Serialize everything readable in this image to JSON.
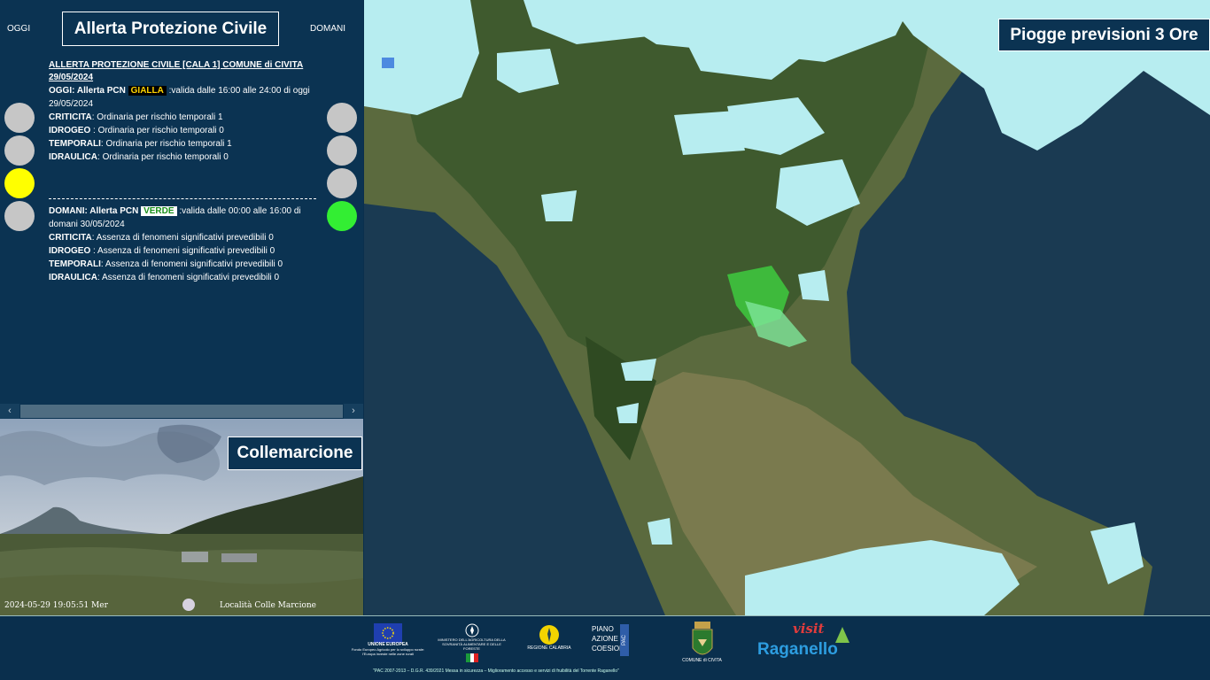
{
  "alert": {
    "title": "Allerta Protezione Civile",
    "left_label": "OGGI",
    "right_label": "DOMANI",
    "header": "ALLERTA PROTEZIONE CIVILE [CALA 1] COMUNE di CIVITA 29/05/2024",
    "today": {
      "prefix": "OGGI: Allerta PCN",
      "level": "GIALLA",
      "validity": ":valida dalle 16:00 alle 24:00 di oggi 29/05/2024",
      "rows": [
        {
          "key": "CRITICITA",
          "sep": ": ",
          "text": "Ordinaria per rischio temporali 1"
        },
        {
          "key": "IDROGEO",
          "sep": " : ",
          "text": "Ordinaria per rischio temporali 0"
        },
        {
          "key": "TEMPORALI",
          "sep": ": ",
          "text": "Ordinaria per rischio temporali 1"
        },
        {
          "key": "IDRAULICA",
          "sep": ": ",
          "text": "Ordinaria per rischio temporali 0"
        }
      ]
    },
    "tomorrow": {
      "prefix": "DOMANI: Allerta PCN",
      "level": "VERDE",
      "validity": ":valida dalle 00:00 alle 16:00 di domani 30/05/2024",
      "rows": [
        {
          "key": "CRITICITA",
          "sep": ": ",
          "text": "Assenza di fenomeni significativi prevedibili 0"
        },
        {
          "key": "IDROGEO",
          "sep": " : ",
          "text": "Assenza di fenomeni significativi prevedibili 0"
        },
        {
          "key": "TEMPORALI",
          "sep": ": ",
          "text": "Assenza di fenomeni significativi prevedibili 0"
        },
        {
          "key": "IDRAULICA",
          "sep": ": ",
          "text": "Assenza di fenomeni significativi prevedibili 0"
        }
      ]
    },
    "lamps_today": [
      "grey",
      "grey",
      "yellow",
      "grey"
    ],
    "lamps_tomorrow": [
      "grey",
      "grey",
      "grey",
      "green"
    ]
  },
  "scrollbar": {
    "left_arrow": "‹",
    "right_arrow": "›"
  },
  "webcam": {
    "title": "Collemarcione",
    "timestamp": "2024-05-29 19:05:51 Mer",
    "location": "Località Colle Marcione"
  },
  "map": {
    "title": "Piogge previsioni 3 Ore"
  },
  "footer": {
    "eu_label": "UNIONE EUROPEA",
    "eu_sub": "Fondo Europeo Agricolo per lo sviluppo rurale: l'Europa investe nelle zone rurali",
    "ministry": "MINISTERO DELL'AGRICOLTURA DELLA SOVRANITÀ ALIMENTARE E DELLE FORESTE",
    "region": "REGIONE CALABRIA",
    "pac_1": "PIANO",
    "pac_2": "AZIONE",
    "pac_3": "COESIONE",
    "pac_badge": "PAC",
    "comune": "COMUNE di CIVITA",
    "visit_1": "visit",
    "visit_2": "Raganello",
    "note": "\"PAC 2007-2013 – D.G.R. 439/2021 Messa in sicurezza – Miglioramento accesso e servizi di fruibilità del Torrente Raganello\""
  },
  "colors": {
    "panel_bg": "#0b3352",
    "yellow": "#ffff00",
    "green": "#33ee33",
    "grey": "#c6c6c6"
  }
}
